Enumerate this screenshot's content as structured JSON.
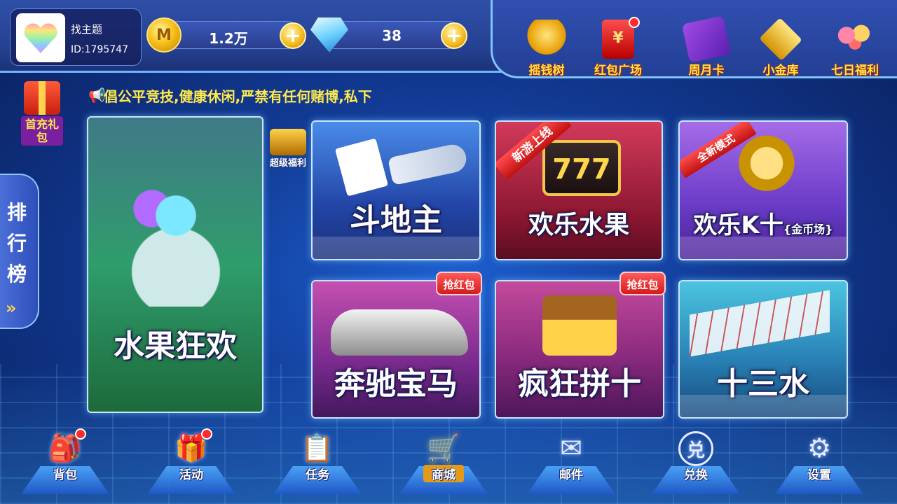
{
  "profile": {
    "nickname": "找主题",
    "user_id": "ID:1795747"
  },
  "currency": {
    "gold": {
      "value": "1.2万",
      "icon": "gold-coin-icon"
    },
    "diamond": {
      "value": "38",
      "icon": "diamond-icon"
    }
  },
  "features": [
    {
      "label": "摇钱树",
      "icon": "money-tree-icon"
    },
    {
      "label": "红包广场",
      "icon": "red-packet-icon"
    },
    {
      "label": "周月卡",
      "icon": "card-icon"
    },
    {
      "label": "小金库",
      "icon": "safe-icon"
    },
    {
      "label": "七日福利",
      "icon": "balloons-icon"
    }
  ],
  "marquee": {
    "text": "倡公平竞技,健康休闲,严禁有任何赌博,私下"
  },
  "side": {
    "first_charge": "首充礼包",
    "rank": "排行榜",
    "super_bonus": "超级福利"
  },
  "games": {
    "fruit_frenzy": "水果狂欢",
    "doudizhu": "斗地主",
    "fruit": "欢乐水果",
    "fruit_tag": "新游上线",
    "k10": "欢乐K十",
    "k10_sub": "{金币场}",
    "k10_tag": "全新模式",
    "benz": "奔驰宝马",
    "benz_tag": "抢红包",
    "pin10": "疯狂拼十",
    "pin10_tag": "抢红包",
    "thirteen": "十三水"
  },
  "nav": [
    {
      "label": "背包",
      "icon": "backpack-icon"
    },
    {
      "label": "活动",
      "icon": "gift-box-icon"
    },
    {
      "label": "任务",
      "icon": "task-icon"
    },
    {
      "label": "商城",
      "icon": "cart-icon"
    },
    {
      "label": "邮件",
      "icon": "mail-icon"
    },
    {
      "label": "兑换",
      "icon": "exchange-icon"
    },
    {
      "label": "设置",
      "icon": "gear-icon"
    }
  ],
  "colors": {
    "accent_gold": "#ffe94d",
    "badge_red": "#ff2a2a"
  }
}
